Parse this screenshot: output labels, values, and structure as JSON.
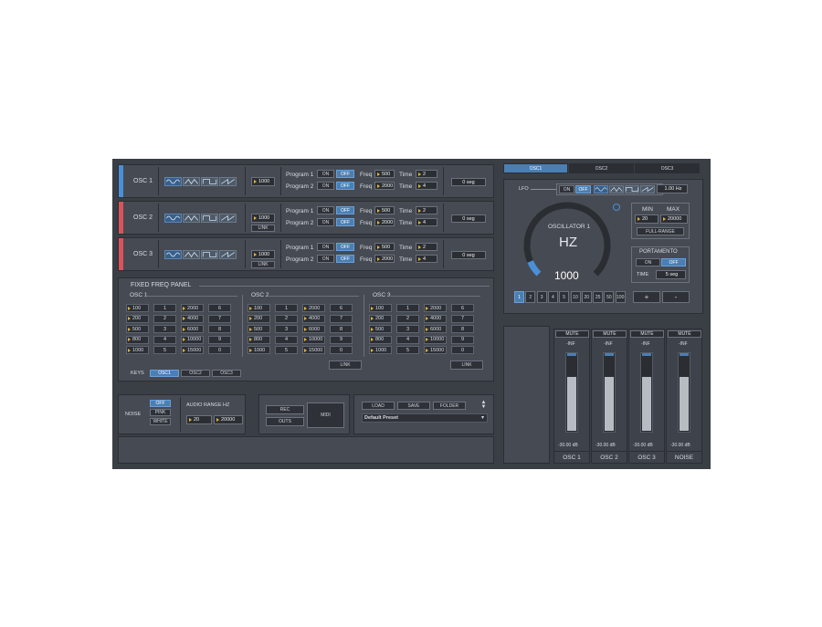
{
  "oscillators": [
    {
      "name": "OSC 1",
      "color": "#4a90d9",
      "freq": "1000",
      "link": "",
      "prog1": {
        "label": "Program 1",
        "freq": "500",
        "time": "2"
      },
      "prog2": {
        "label": "Program 2",
        "freq": "2000",
        "time": "4"
      },
      "seg": "0 seg"
    },
    {
      "name": "OSC 2",
      "color": "#d9545a",
      "freq": "1000",
      "link": "LINK",
      "prog1": {
        "label": "Program 1",
        "freq": "500",
        "time": "2"
      },
      "prog2": {
        "label": "Program 2",
        "freq": "2000",
        "time": "4"
      },
      "seg": "0 seg"
    },
    {
      "name": "OSC 3",
      "color": "#d9545a",
      "freq": "1000",
      "link": "LINK",
      "prog1": {
        "label": "Program 1",
        "freq": "500",
        "time": "2"
      },
      "prog2": {
        "label": "Program 2",
        "freq": "2000",
        "time": "4"
      },
      "seg": "0 seg"
    }
  ],
  "common": {
    "on": "ON",
    "off": "OFF",
    "freq": "Freq",
    "time": "Time"
  },
  "fixed_panel": {
    "title": "FIXED FREQ PANEL",
    "groups": [
      {
        "name": "OSC 1",
        "link": ""
      },
      {
        "name": "OSC 2",
        "link": "LINK"
      },
      {
        "name": "OSC 3",
        "link": "LINK"
      }
    ],
    "rows": [
      [
        "100",
        "1",
        "2000",
        "6"
      ],
      [
        "200",
        "2",
        "4000",
        "7"
      ],
      [
        "500",
        "3",
        "6000",
        "8"
      ],
      [
        "800",
        "4",
        "10000",
        "9"
      ],
      [
        "1000",
        "5",
        "15000",
        "0"
      ]
    ],
    "keys_label": "KEYS",
    "keys_tabs": [
      "OSC1",
      "OSC2",
      "OSC3"
    ]
  },
  "noise": {
    "label": "NOISE",
    "options": [
      "OFF",
      "PINK",
      "WHITE"
    ],
    "selected": "OFF",
    "range_label": "AUDIO RANGE HZ",
    "range_min": "20",
    "range_max": "20000"
  },
  "io": {
    "rec": "REC",
    "outs": "OUTS",
    "midi": "MIDI"
  },
  "preset": {
    "load": "LOAD",
    "save": "SAVE",
    "folder": "FOLDER",
    "current": "Default Preset"
  },
  "right_tabs": [
    "OSC1",
    "OSC2",
    "OSC3"
  ],
  "lfo": {
    "label": "LFO",
    "on": "ON",
    "off": "OFF",
    "rate": "1.00 Hz"
  },
  "knob": {
    "title": "OSCILLATOR 1",
    "unit": "HZ",
    "value": "1000",
    "fraction": 0.08
  },
  "minmax": {
    "min_label": "MIN",
    "max_label": "MAX",
    "min": "20",
    "max": "20000",
    "full_range": "FULL-RANGE"
  },
  "portamento": {
    "label": "PORTAMENTO",
    "on": "ON",
    "off": "OFF",
    "time_label": "TIME",
    "time": "5 seg"
  },
  "multipliers": [
    "1",
    "2",
    "3",
    "4",
    "5",
    "10",
    "20",
    "25",
    "50",
    "100"
  ],
  "plus": "+",
  "minus": "-",
  "mixer": [
    {
      "name": "OSC 1",
      "mute": "MUTE",
      "peak": "-INF",
      "db": "-30.00 dB",
      "level": 0.69
    },
    {
      "name": "OSC 2",
      "mute": "MUTE",
      "peak": "-INF",
      "db": "-30.00 dB",
      "level": 0.69
    },
    {
      "name": "OSC 3",
      "mute": "MUTE",
      "peak": "-INF",
      "db": "-30.00 dB",
      "level": 0.69
    },
    {
      "name": "NOISE",
      "mute": "MUTE",
      "peak": "-INF",
      "db": "-30.00 dB",
      "level": 0.69
    }
  ],
  "colors": {
    "accent": "#4a7fb4",
    "value_marker": "#e0b43c",
    "osc1": "#4a90d9",
    "osc_other": "#d9545a"
  }
}
